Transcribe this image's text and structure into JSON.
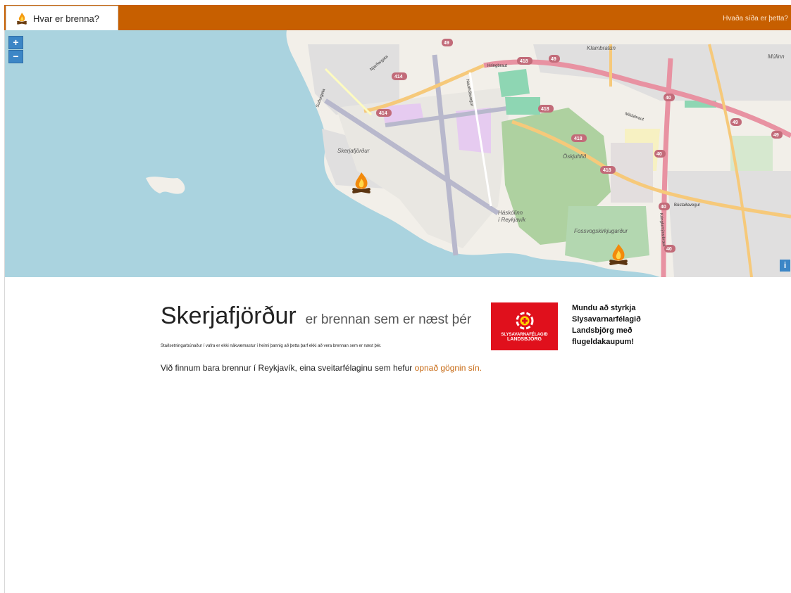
{
  "navbar": {
    "brand_label": "Hvar er brenna?",
    "about_link": "Hvaða síða er þetta?",
    "color": "#c75f00"
  },
  "map": {
    "zoom_in": "+",
    "zoom_out": "−",
    "info": "i",
    "labels": {
      "skerjafjordur": "Skerjafjörður",
      "oskjuhlid": "Öskjuhlíð",
      "haskolinn1": "Háskólinn",
      "haskolinn2": "í Reykjavík",
      "fossvogur": "Fossvogskirkjugarður",
      "klambratun": "Klambratún",
      "mulinn": "Múlinn",
      "bustadavegur": "Bústaðavegur",
      "miklabraut": "Miklabraut",
      "hringbraut": "Hringbraut",
      "njardargata": "Njarðargata",
      "sudurgata": "Suðurgata",
      "nauthólsvegur": "Nauthólsvegur",
      "kringlumyrarbraut": "Kringlumýrarbraut",
      "r49": "49",
      "r40": "40",
      "r414": "414",
      "r418": "418"
    },
    "markers": [
      "bonfire-skerjafjordur",
      "bonfire-fossvogur"
    ],
    "colors": {
      "water": "#aad3df",
      "land": "#f2efe9",
      "park": "#c8facc",
      "road": "#f6c97a",
      "motorway": "#e892a2"
    }
  },
  "result": {
    "place": "Skerjafjörður",
    "suffix": "er brennan sem er næst þér",
    "note": "Staðsetningarbúnaður í vafra er ekki nákvæmastur í heimi þannig að þetta þarf ekki að vera brennan sem er næst þér.",
    "lead_text": "Við finnum bara brennur í Reykjavík, eina sveitarfélaginu sem hefur ",
    "lead_link": "opnað gögnin sín."
  },
  "sponsor": {
    "logo_line1": "SLYSAVARNAFÉLAGIÐ",
    "logo_line2": "LANDSBJÖRG",
    "text": "Mundu að styrkja Slysavarnarfélagið Landsbjörg með flugeldakaupum!",
    "color": "#e0101c"
  }
}
